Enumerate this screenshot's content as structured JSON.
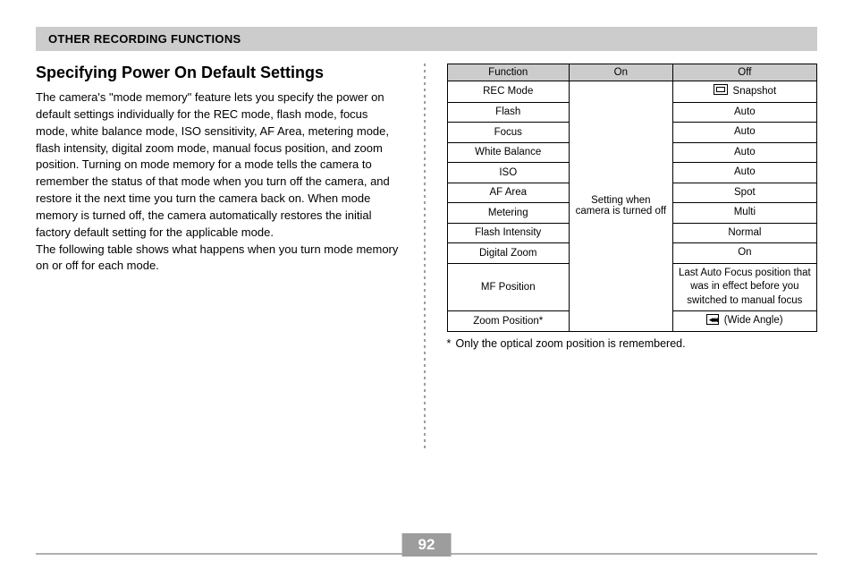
{
  "section_bar": "OTHER RECORDING FUNCTIONS",
  "heading": "Specifying Power On Default Settings",
  "paragraph1": "The camera's \"mode memory\" feature lets you specify the power on default settings individually for the REC mode, flash mode, focus mode, white balance mode, ISO sensitivity, AF Area, metering mode, flash intensity, digital zoom mode, manual focus position, and zoom position. Turning on mode memory for a mode tells the camera to remember the status of that mode when you turn off the camera, and restore it the next time you turn the camera back on. When mode memory is turned off, the camera automatically restores the initial factory default setting for the applicable mode.",
  "paragraph2": "The following table shows what happens when you turn mode memory on or off for each mode.",
  "table": {
    "headers": {
      "function": "Function",
      "on": "On",
      "off": "Off"
    },
    "on_text": "Setting when camera is turned off",
    "rows": {
      "rec": {
        "fn": "REC Mode",
        "off": "Snapshot"
      },
      "flash": {
        "fn": "Flash",
        "off": "Auto"
      },
      "focus": {
        "fn": "Focus",
        "off": "Auto"
      },
      "wb": {
        "fn": "White Balance",
        "off": "Auto"
      },
      "iso": {
        "fn": "ISO",
        "off": "Auto"
      },
      "af": {
        "fn": "AF Area",
        "off": "Spot"
      },
      "metering": {
        "fn": "Metering",
        "off": "Multi"
      },
      "fi": {
        "fn": "Flash Intensity",
        "off": "Normal"
      },
      "dz": {
        "fn": "Digital Zoom",
        "off": "On"
      },
      "mf": {
        "fn": "MF Position",
        "off": "Last Auto Focus position that was in effect before you switched to manual focus"
      },
      "zoom": {
        "fn": "Zoom Position*",
        "off": "(Wide Angle)"
      }
    }
  },
  "footnote_marker": "*",
  "footnote": "Only the optical zoom position is remembered.",
  "page_number": "92"
}
